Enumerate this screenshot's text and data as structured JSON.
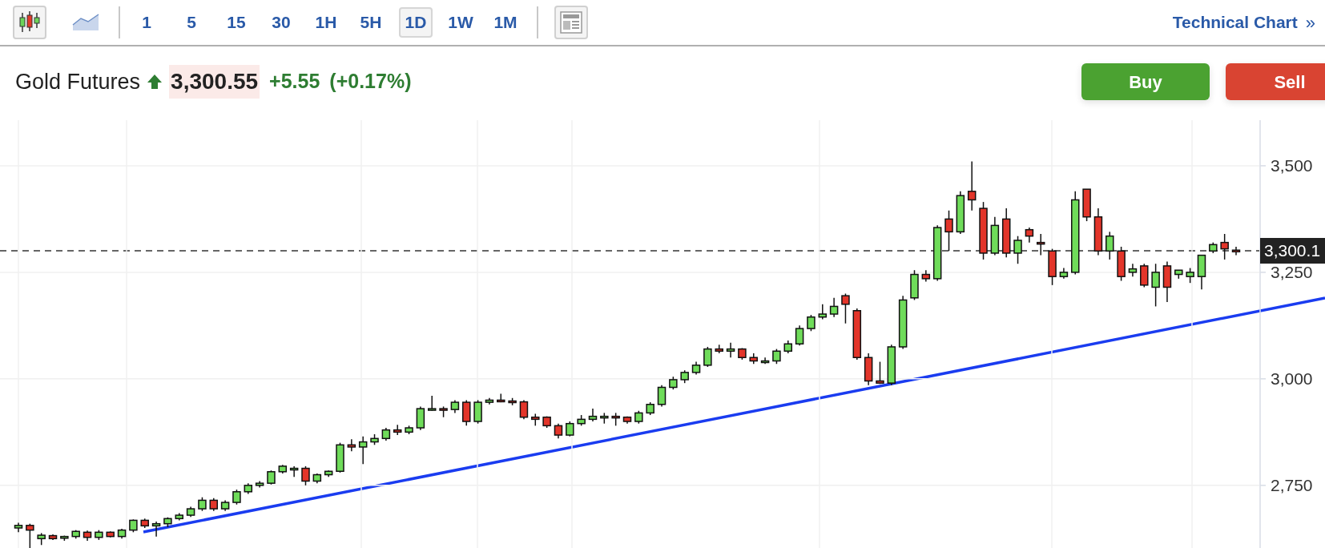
{
  "toolbar": {
    "chart_types": [
      {
        "kind": "candlestick",
        "selected": true
      },
      {
        "kind": "area",
        "selected": false
      }
    ],
    "intervals": [
      {
        "label": "1",
        "selected": false
      },
      {
        "label": "5",
        "selected": false
      },
      {
        "label": "15",
        "selected": false
      },
      {
        "label": "30",
        "selected": false
      },
      {
        "label": "1H",
        "selected": false
      },
      {
        "label": "5H",
        "selected": false
      },
      {
        "label": "1D",
        "selected": true
      },
      {
        "label": "1W",
        "selected": false
      },
      {
        "label": "1M",
        "selected": false
      }
    ],
    "technical_link": {
      "label": "Technical Chart",
      "chevron": "»"
    }
  },
  "quote": {
    "name": "Gold Futures",
    "rising": true,
    "price": "3,300.55",
    "change": "+5.55",
    "change_percent": "(+0.17%)"
  },
  "actions": [
    {
      "kind": "buy",
      "label": "Buy"
    },
    {
      "kind": "sell",
      "label": "Sell"
    }
  ],
  "chart": {
    "last_price_label": "3,300.1",
    "chart_data": {
      "type": "candlestick",
      "ylim": [
        2603,
        3607
      ],
      "grid": true,
      "yticks": [
        {
          "value": 3500,
          "label": "3,500"
        },
        {
          "value": 3250,
          "label": "3,250"
        },
        {
          "value": 3000,
          "label": "3,000"
        },
        {
          "value": 2750,
          "label": "2,750"
        }
      ],
      "categories": [
        null,
        null,
        null,
        null,
        null,
        null,
        null,
        null,
        null,
        null,
        null,
        null,
        null,
        null,
        null,
        null,
        null,
        null,
        null,
        null,
        null,
        null,
        null,
        null,
        null,
        null,
        null,
        null,
        null,
        null,
        null,
        null,
        null,
        null,
        null,
        null,
        null,
        null,
        null,
        null,
        null,
        null,
        null,
        null,
        null,
        null,
        null,
        null,
        null,
        null,
        null,
        null,
        null,
        null,
        null,
        null,
        null,
        null,
        null,
        null,
        null,
        null,
        null,
        null,
        null,
        null,
        null,
        null,
        null,
        null,
        null,
        null,
        null,
        null,
        null,
        null,
        null,
        null,
        null,
        null,
        null,
        null,
        null,
        null,
        null,
        null,
        null,
        null,
        null,
        null,
        null,
        null,
        null,
        null,
        null,
        null,
        null,
        null,
        null,
        null,
        null,
        null,
        null,
        null,
        null,
        null,
        null
      ],
      "ohlc": [
        [
          2650,
          2662,
          2640,
          2656
        ],
        [
          2656,
          2660,
          2600,
          2645
        ],
        [
          2625,
          2638,
          2610,
          2633
        ],
        [
          2632,
          2635,
          2622,
          2625
        ],
        [
          2626,
          2632,
          2620,
          2630
        ],
        [
          2630,
          2645,
          2625,
          2642
        ],
        [
          2640,
          2644,
          2620,
          2628
        ],
        [
          2628,
          2645,
          2622,
          2640
        ],
        [
          2640,
          2642,
          2628,
          2630
        ],
        [
          2630,
          2648,
          2625,
          2645
        ],
        [
          2645,
          2670,
          2640,
          2668
        ],
        [
          2668,
          2672,
          2650,
          2655
        ],
        [
          2655,
          2665,
          2630,
          2660
        ],
        [
          2660,
          2675,
          2652,
          2672
        ],
        [
          2672,
          2685,
          2668,
          2680
        ],
        [
          2680,
          2700,
          2676,
          2695
        ],
        [
          2695,
          2722,
          2690,
          2715
        ],
        [
          2715,
          2720,
          2690,
          2695
        ],
        [
          2695,
          2715,
          2690,
          2710
        ],
        [
          2710,
          2740,
          2705,
          2735
        ],
        [
          2735,
          2755,
          2730,
          2750
        ],
        [
          2750,
          2760,
          2745,
          2755
        ],
        [
          2755,
          2785,
          2752,
          2782
        ],
        [
          2782,
          2798,
          2778,
          2795
        ],
        [
          2790,
          2795,
          2770,
          2790
        ],
        [
          2790,
          2795,
          2750,
          2760
        ],
        [
          2760,
          2778,
          2755,
          2775
        ],
        [
          2775,
          2785,
          2770,
          2783
        ],
        [
          2783,
          2850,
          2780,
          2845
        ],
        [
          2845,
          2858,
          2830,
          2840
        ],
        [
          2840,
          2865,
          2800,
          2852
        ],
        [
          2852,
          2870,
          2845,
          2860
        ],
        [
          2860,
          2885,
          2855,
          2880
        ],
        [
          2880,
          2892,
          2868,
          2875
        ],
        [
          2875,
          2890,
          2870,
          2885
        ],
        [
          2885,
          2935,
          2880,
          2930
        ],
        [
          2930,
          2960,
          2925,
          2930
        ],
        [
          2930,
          2935,
          2910,
          2928
        ],
        [
          2928,
          2950,
          2920,
          2945
        ],
        [
          2945,
          2950,
          2890,
          2900
        ],
        [
          2900,
          2950,
          2895,
          2945
        ],
        [
          2945,
          2955,
          2940,
          2950
        ],
        [
          2950,
          2965,
          2945,
          2948
        ],
        [
          2948,
          2955,
          2938,
          2946
        ],
        [
          2946,
          2950,
          2905,
          2910
        ],
        [
          2910,
          2918,
          2890,
          2905
        ],
        [
          2910,
          2912,
          2885,
          2890
        ],
        [
          2890,
          2895,
          2860,
          2868
        ],
        [
          2868,
          2900,
          2865,
          2895
        ],
        [
          2895,
          2915,
          2890,
          2905
        ],
        [
          2905,
          2930,
          2900,
          2912
        ],
        [
          2912,
          2920,
          2895,
          2912
        ],
        [
          2912,
          2920,
          2890,
          2910
        ],
        [
          2910,
          2912,
          2895,
          2900
        ],
        [
          2900,
          2925,
          2895,
          2920
        ],
        [
          2920,
          2945,
          2915,
          2940
        ],
        [
          2940,
          2985,
          2935,
          2980
        ],
        [
          2980,
          3005,
          2975,
          2998
        ],
        [
          2998,
          3020,
          2990,
          3015
        ],
        [
          3015,
          3040,
          3010,
          3032
        ],
        [
          3032,
          3075,
          3028,
          3070
        ],
        [
          3070,
          3080,
          3060,
          3065
        ],
        [
          3065,
          3085,
          3050,
          3070
        ],
        [
          3070,
          3072,
          3045,
          3050
        ],
        [
          3050,
          3060,
          3035,
          3042
        ],
        [
          3042,
          3050,
          3035,
          3042
        ],
        [
          3042,
          3070,
          3035,
          3065
        ],
        [
          3065,
          3090,
          3060,
          3082
        ],
        [
          3082,
          3125,
          3078,
          3118
        ],
        [
          3118,
          3150,
          3112,
          3145
        ],
        [
          3145,
          3175,
          3140,
          3152
        ],
        [
          3152,
          3190,
          3145,
          3170
        ],
        [
          3195,
          3200,
          3130,
          3175
        ],
        [
          3160,
          3165,
          3045,
          3050
        ],
        [
          3050,
          3060,
          2985,
          2995
        ],
        [
          2995,
          3040,
          2988,
          2990
        ],
        [
          2990,
          3080,
          2985,
          3075
        ],
        [
          3075,
          3195,
          3070,
          3185
        ],
        [
          3190,
          3255,
          3185,
          3245
        ],
        [
          3245,
          3255,
          3228,
          3235
        ],
        [
          3235,
          3360,
          3230,
          3355
        ],
        [
          3375,
          3395,
          3300,
          3345
        ],
        [
          3345,
          3440,
          3340,
          3430
        ],
        [
          3440,
          3510,
          3395,
          3420
        ],
        [
          3400,
          3415,
          3280,
          3295
        ],
        [
          3295,
          3380,
          3290,
          3360
        ],
        [
          3375,
          3400,
          3285,
          3295
        ],
        [
          3295,
          3335,
          3270,
          3325
        ],
        [
          3350,
          3355,
          3320,
          3335
        ],
        [
          3320,
          3340,
          3290,
          3318
        ],
        [
          3300,
          3305,
          3220,
          3240
        ],
        [
          3240,
          3260,
          3235,
          3250
        ],
        [
          3250,
          3440,
          3245,
          3420
        ],
        [
          3445,
          3445,
          3370,
          3380
        ],
        [
          3380,
          3400,
          3290,
          3300
        ],
        [
          3300,
          3345,
          3280,
          3335
        ],
        [
          3300,
          3310,
          3230,
          3240
        ],
        [
          3250,
          3270,
          3240,
          3258
        ],
        [
          3265,
          3270,
          3215,
          3220
        ],
        [
          3215,
          3270,
          3170,
          3250
        ],
        [
          3265,
          3275,
          3180,
          3215
        ],
        [
          3245,
          3255,
          3235,
          3255
        ],
        [
          3240,
          3260,
          3225,
          3250
        ],
        [
          3240,
          3290,
          3210,
          3290
        ],
        [
          3300,
          3320,
          3295,
          3315
        ],
        [
          3320,
          3340,
          3280,
          3305
        ],
        [
          3302,
          3310,
          3290,
          3300
        ]
      ]
    }
  }
}
